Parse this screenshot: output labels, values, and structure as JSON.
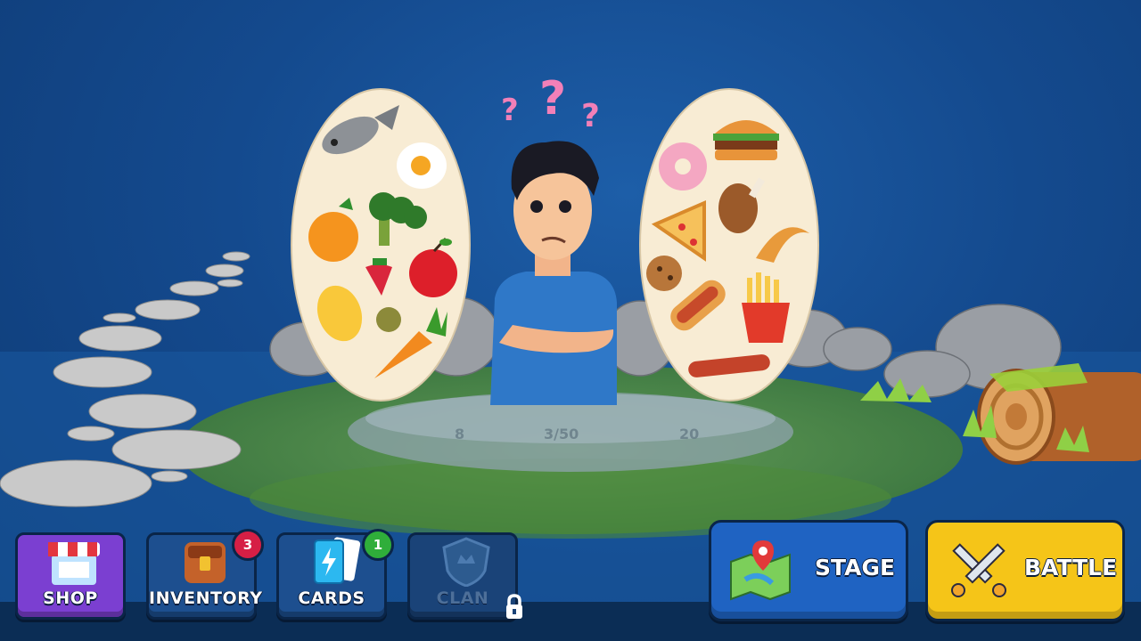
{
  "nav": {
    "shop": {
      "label": "SHOP"
    },
    "inventory": {
      "label": "INVENTORY",
      "badge": "3"
    },
    "cards": {
      "label": "CARDS",
      "badge": "1"
    },
    "clan": {
      "label": "CLAN",
      "locked": true
    }
  },
  "actions": {
    "stage": {
      "label": "STAGE"
    },
    "battle": {
      "label": "BATTLE"
    }
  },
  "scene": {
    "question_marks": [
      "?",
      "?",
      "?"
    ],
    "faded_text": [
      "8",
      "3/50",
      "20"
    ],
    "healthy_foods": [
      "fish-icon",
      "egg-icon",
      "orange-icon",
      "broccoli-icon",
      "strawberry-icon",
      "apple-icon",
      "lemon-icon",
      "olive-icon",
      "carrot-icon"
    ],
    "junk_foods": [
      "donut-icon",
      "burger-icon",
      "pizza-icon",
      "drumstick-icon",
      "croissant-icon",
      "cookie-icon",
      "hotdog-icon",
      "fries-icon",
      "sausage-icon"
    ]
  },
  "colors": {
    "shop": "#7b3fd1",
    "nav_blue": "#1d4f8f",
    "stage": "#1f63c2",
    "battle": "#f5c518",
    "badge_red": "#d61f45",
    "badge_green": "#2fae3a"
  }
}
